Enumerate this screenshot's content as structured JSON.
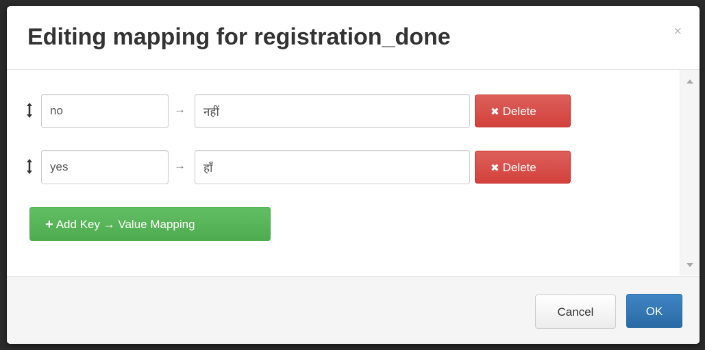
{
  "dialog": {
    "title": "Editing mapping for registration_done",
    "close_symbol": "×"
  },
  "mappings": [
    {
      "key": "no",
      "value": "नहीं",
      "delete_label": "Delete"
    },
    {
      "key": "yes",
      "value": "हाँ",
      "delete_label": "Delete"
    }
  ],
  "arrow_symbol": "→",
  "add_button": {
    "label": "Add Key → Value Mapping",
    "icon": "plus-icon"
  },
  "footer": {
    "cancel_label": "Cancel",
    "ok_label": "OK"
  },
  "icons": {
    "drag": "drag-handle-icon",
    "delete": "x-icon",
    "close": "close-icon"
  },
  "colors": {
    "danger": "#d9534f",
    "success": "#5cb85c",
    "primary": "#337ab7"
  }
}
